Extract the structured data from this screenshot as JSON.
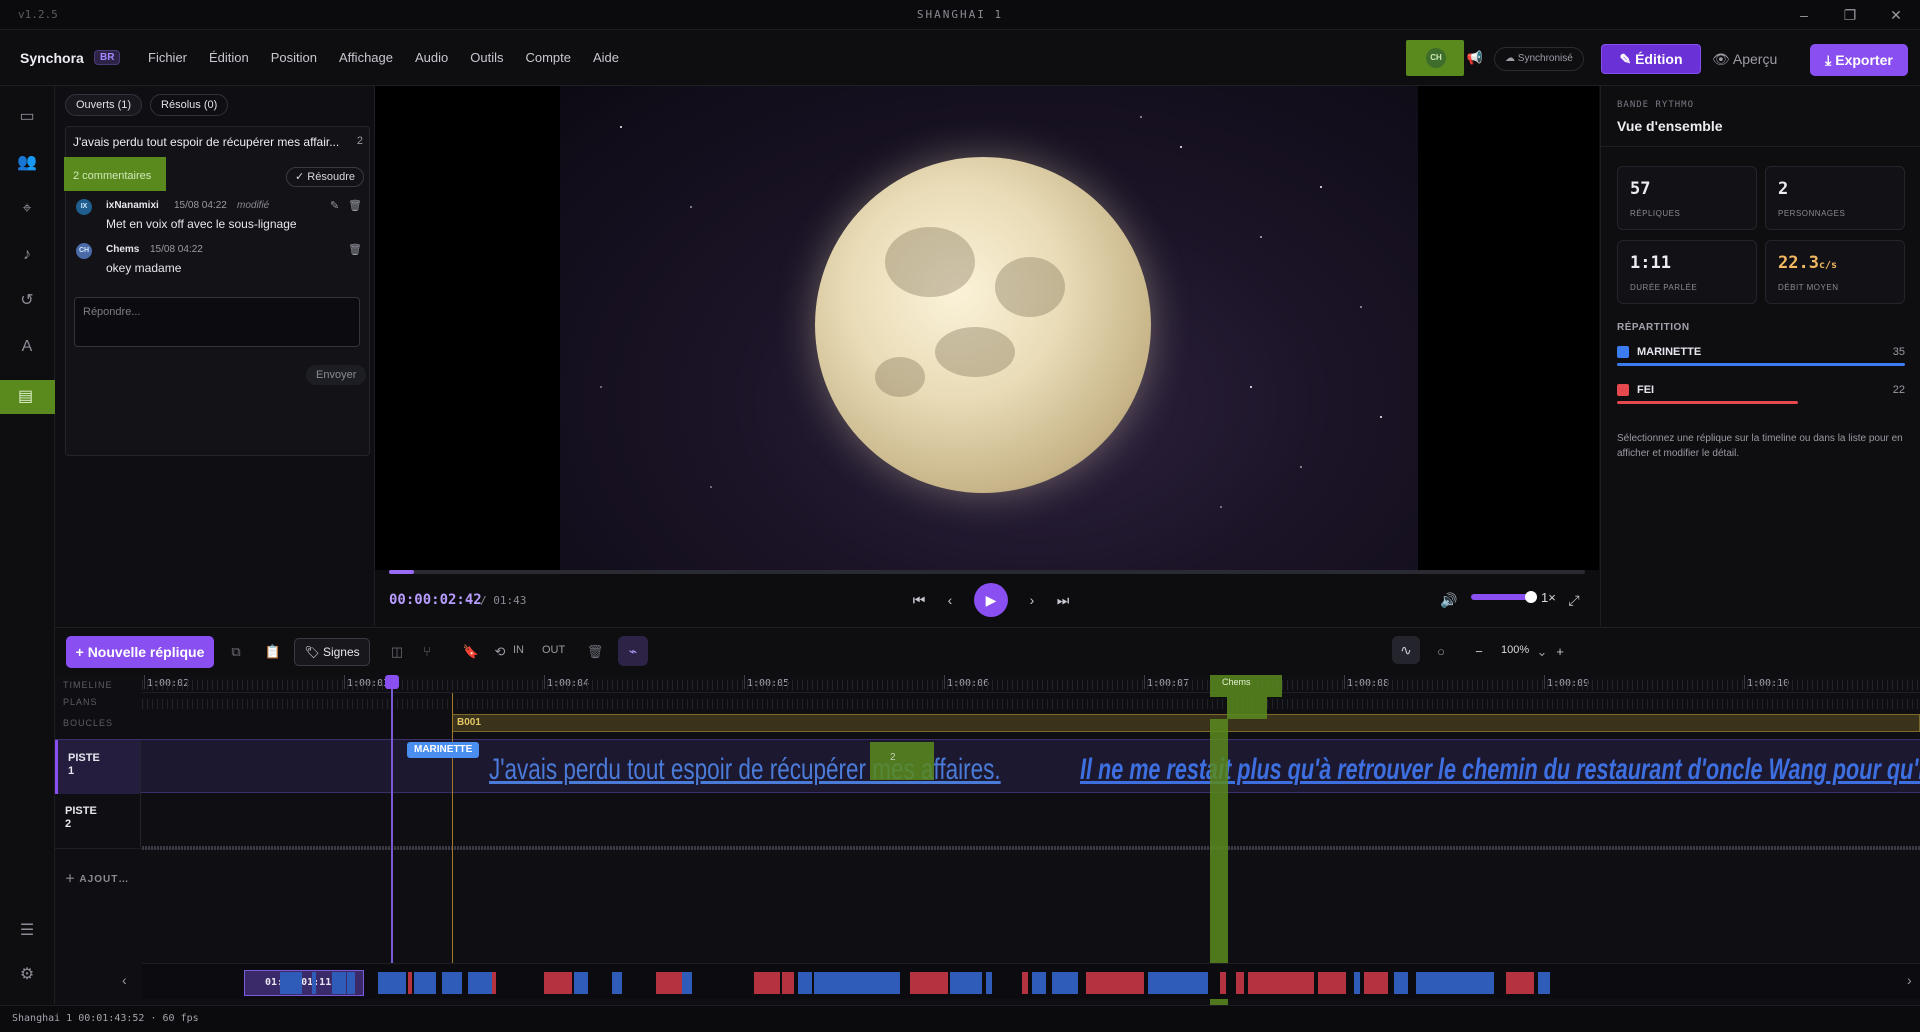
{
  "titlebar": {
    "version": "v1.2.5",
    "title": "SHANGHAI 1"
  },
  "brand": {
    "name": "Synchora",
    "badge": "BR"
  },
  "menu": [
    "Fichier",
    "Édition",
    "Position",
    "Affichage",
    "Audio",
    "Outils",
    "Compte",
    "Aide"
  ],
  "header": {
    "avatar": "CH",
    "sync_label": "Synchronisé",
    "edit_label": "Édition",
    "preview_label": "Aperçu",
    "export_label": "Exporter"
  },
  "comments": {
    "tabs": [
      "Ouverts (1)",
      "Résolus (0)"
    ],
    "thread_title": "J'avais perdu tout espoir de récupérer mes affair...",
    "thread_count": "2",
    "count_label": "2 commentaires",
    "resolve_label": "Résoudre",
    "items": [
      {
        "initials": "IX",
        "author": "ixNanamixi",
        "date": "15/08 04:22",
        "modified": "modifié",
        "text": "Met en voix off avec le sous-lignage"
      },
      {
        "initials": "CH",
        "author": "Chems",
        "date": "15/08 04:22",
        "modified": "",
        "text": "okey madame"
      }
    ],
    "reply_placeholder": "Répondre...",
    "send_label": "Envoyer"
  },
  "player": {
    "timecode": "00:00:02:42",
    "duration": "/ 01:43",
    "progress": 0.021,
    "volume": 0.8,
    "speed": "1×"
  },
  "overview": {
    "label": "BANDE RYTHMO",
    "title": "Vue d'ensemble",
    "stats": [
      {
        "value": "57",
        "label": "RÉPLIQUES"
      },
      {
        "value": "2",
        "label": "PERSONNAGES"
      },
      {
        "value": "1:11",
        "label": "DURÉE PARLÉE"
      },
      {
        "value": "22.3",
        "unit": "c/s",
        "label": "DÉBIT MOYEN"
      }
    ],
    "repartition_label": "RÉPARTITION",
    "people": [
      {
        "name": "MARINETTE",
        "count": "35",
        "color": "#3b7cf0",
        "share": 1.0
      },
      {
        "name": "FEI",
        "count": "22",
        "color": "#e5484d",
        "share": 0.63
      }
    ],
    "help": "Sélectionnez une réplique sur la timeline ou dans la liste pour en afficher et modifier le détail."
  },
  "toolbar": {
    "new_label": "Nouvelle réplique",
    "signes_label": "Signes",
    "in_label": "IN",
    "out_label": "OUT",
    "zoom": "100%"
  },
  "timeline": {
    "row_labels": {
      "timeline": "TIMELINE",
      "plans": "PLANS",
      "boucles": "BOUCLES"
    },
    "ticks": [
      "1:00:02",
      "1:00:03",
      "1:00:04",
      "1:00:05",
      "1:00:06",
      "1:00:07",
      "1:00:08",
      "1:00:09",
      "1:00:10"
    ],
    "boucle": "B001",
    "tracks": [
      {
        "line1": "PISTE",
        "line2": "1"
      },
      {
        "line1": "PISTE",
        "line2": "2"
      }
    ],
    "add_label": "AJOUT…",
    "speaker": "MARINETTE",
    "line1": "J'avais perdu tout espoir de récupérer mes affaires.",
    "line2": "Il ne me restait plus qu'à retrouver le chemin du restaurant d'oncle Wang pour qu'il m'aide,",
    "comment_marker": "2",
    "cursor_label": "Chems",
    "minimap_time": "01:00:01:11"
  },
  "status": "Shanghai 1  00:01:43:52 · 60 fps"
}
